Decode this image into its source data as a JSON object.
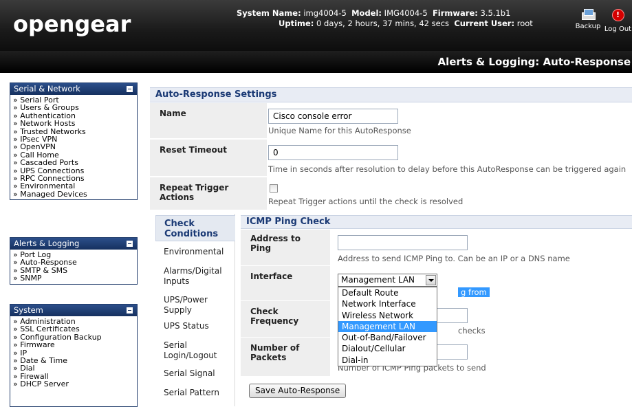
{
  "header": {
    "logo": "opengear",
    "system_name_label": "System Name:",
    "system_name": "img4004-5",
    "model_label": "Model:",
    "model": "IMG4004-5",
    "firmware_label": "Firmware:",
    "firmware": "3.5.1b1",
    "uptime_label": "Uptime:",
    "uptime": "0 days, 2 hours, 37 mins, 42 secs",
    "current_user_label": "Current User:",
    "current_user": "root",
    "backup_label": "Backup",
    "logout_label": "Log Out",
    "page_title": "Alerts & Logging: Auto-Response"
  },
  "sidebar": {
    "serial_network": {
      "title": "Serial & Network",
      "items": [
        "Serial Port",
        "Users & Groups",
        "Authentication",
        "Network Hosts",
        "Trusted Networks",
        "IPsec VPN",
        "OpenVPN",
        "Call Home",
        "Cascaded Ports",
        "UPS Connections",
        "RPC Connections",
        "Environmental",
        "Managed Devices"
      ]
    },
    "alerts_logging": {
      "title": "Alerts & Logging",
      "items": [
        "Port Log",
        "Auto-Response",
        "SMTP & SMS",
        "SNMP"
      ]
    },
    "system": {
      "title": "System",
      "items": [
        "Administration",
        "SSL Certificates",
        "Configuration Backup",
        "Firmware",
        "IP",
        "Date & Time",
        "Dial",
        "Firewall",
        "DHCP Server"
      ]
    }
  },
  "settings": {
    "heading": "Auto-Response Settings",
    "name_label": "Name",
    "name_value": "Cisco console error",
    "name_hint": "Unique Name for this AutoResponse",
    "reset_label": "Reset Timeout",
    "reset_value": "0",
    "reset_hint": "Time in seconds after resolution to delay before this AutoResponse can be triggered again",
    "repeat_label_1": "Repeat Trigger",
    "repeat_label_2": "Actions",
    "repeat_hint": "Repeat Trigger actions until the check is resolved"
  },
  "tabs": {
    "check_conditions_1": "Check",
    "check_conditions_2": "Conditions",
    "environmental": "Environmental",
    "alarms_1": "Alarms/Digital",
    "alarms_2": "Inputs",
    "ups_power_1": "UPS/Power",
    "ups_power_2": "Supply",
    "ups_status": "UPS Status",
    "serial_login_1": "Serial",
    "serial_login_2": "Login/Logout",
    "serial_signal": "Serial Signal",
    "serial_pattern": "Serial Pattern"
  },
  "icmp": {
    "heading": "ICMP Ping Check",
    "address_label_1": "Address to",
    "address_label_2": "Ping",
    "address_value": "",
    "address_hint": "Address to send ICMP Ping to. Can be an IP or a DNS name",
    "interface_label": "Interface",
    "interface_selected": "Management LAN",
    "interface_hint_visible": "g from",
    "interface_options": [
      "Default Route",
      "Network Interface",
      "Wireless Network",
      "Management LAN",
      "Out-of-Band/Failover",
      "Dialout/Cellular",
      "Dial-in"
    ],
    "frequency_label_1": "Check",
    "frequency_label_2": "Frequency",
    "frequency_hint_visible": "checks",
    "packets_label_1": "Number of",
    "packets_label_2": "Packets",
    "packets_hint": "Number of ICMP Ping packets to send",
    "save_button": "Save Auto-Response"
  }
}
